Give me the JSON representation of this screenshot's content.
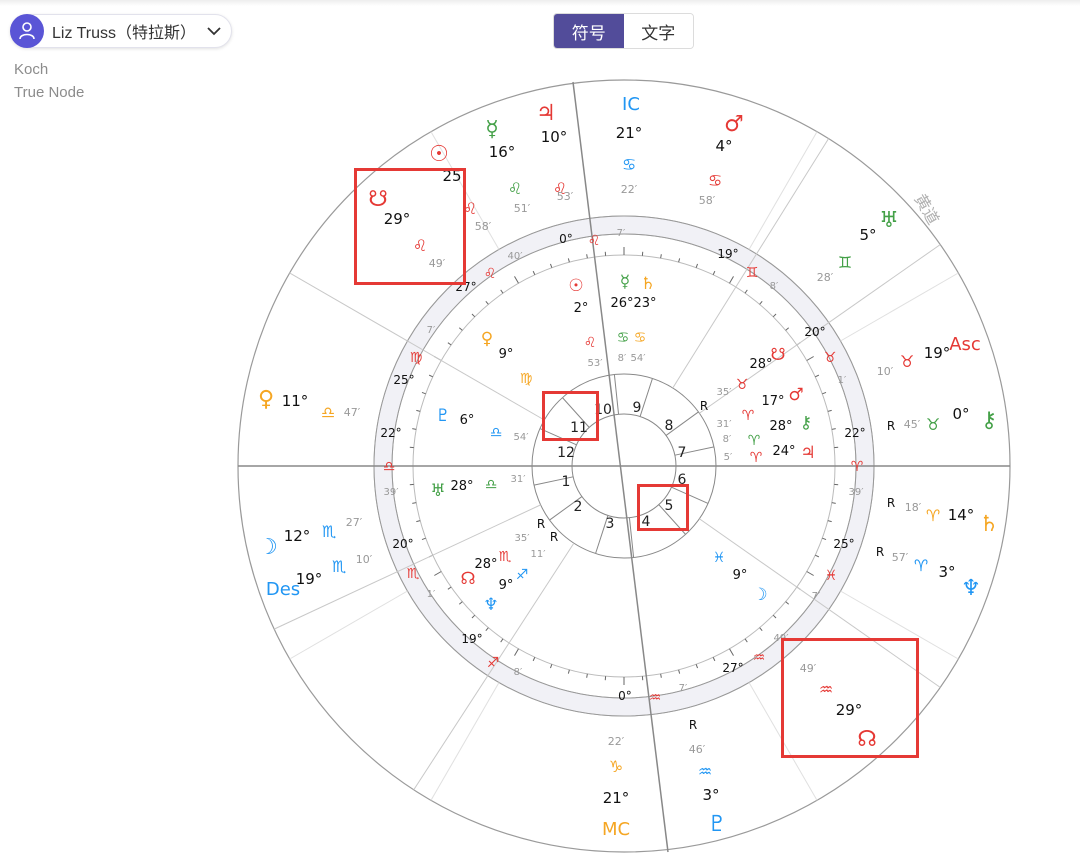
{
  "profile": {
    "name": "Liz Truss（特拉斯）",
    "avatar_icon": "user-icon",
    "dropdown_icon": "chevron-down-icon"
  },
  "settings": {
    "house_system": "Koch",
    "node": "True Node"
  },
  "toggle": {
    "symbols": "符号",
    "text": "文字",
    "active": "symbols"
  },
  "chart": {
    "ring_label": "黄道",
    "angles": [
      {
        "name": "IC",
        "deg": "21°",
        "sign": "♋",
        "min": "22′",
        "color": "#2196f3"
      },
      {
        "name": "Asc",
        "deg": "19°",
        "sign": "♉",
        "min": "10′",
        "color": "#e53935"
      },
      {
        "name": "Des",
        "deg": "19°",
        "sign": "♏",
        "min": "10′",
        "color": "#2196f3"
      },
      {
        "name": "MC",
        "deg": "21°",
        "sign": "♑",
        "min": "22′",
        "color": "#f5a623"
      }
    ],
    "outer_planets": [
      {
        "glyph": "♃",
        "deg": "10°",
        "sign": "♌",
        "min": "53′",
        "color": "#e53935"
      },
      {
        "glyph": "☿",
        "deg": "16°",
        "sign": "♌",
        "min": "51′",
        "color": "#43a047"
      },
      {
        "glyph": "☉",
        "deg": "25",
        "sign": "♌",
        "min": "58′",
        "color": "#e53935"
      },
      {
        "glyph": "☋",
        "deg": "29°",
        "sign": "♌",
        "min": "49′",
        "color": "#e53935"
      },
      {
        "glyph": "♂",
        "deg": "4°",
        "sign": "♋",
        "min": "58′",
        "color": "#e53935"
      },
      {
        "glyph": "♅",
        "deg": "5°",
        "sign": "♊",
        "min": "28′",
        "color": "#43a047"
      },
      {
        "glyph": "⚷",
        "deg": "0°",
        "sign": "♉",
        "min": "45′",
        "color": "#43a047",
        "retro": "R"
      },
      {
        "glyph": "♄",
        "deg": "14°",
        "sign": "♈",
        "min": "18′",
        "color": "#f5a623",
        "retro": "R"
      },
      {
        "glyph": "♆",
        "deg": "3°",
        "sign": "♈",
        "min": "57′",
        "color": "#2196f3",
        "retro": "R"
      },
      {
        "glyph": "☊",
        "deg": "29°",
        "sign": "♒",
        "min": "49′",
        "color": "#e53935"
      },
      {
        "glyph": "♇",
        "deg": "3°",
        "sign": "♒",
        "min": "46′",
        "color": "#2196f3",
        "retro": "R"
      },
      {
        "glyph": "♀",
        "deg": "11°",
        "sign": "♎",
        "min": "47′",
        "color": "#f5a623"
      },
      {
        "glyph": "☽",
        "deg": "12°",
        "sign": "♏",
        "min": "27′",
        "color": "#2196f3"
      }
    ],
    "inner_planets": [
      {
        "glyph": "☉",
        "deg": "2°",
        "sign": "♌",
        "min": "53′",
        "color": "#e53935"
      },
      {
        "glyph": "☿",
        "deg": "26°",
        "sign": "♋",
        "min": "8′",
        "color": "#43a047"
      },
      {
        "glyph": "♄",
        "deg": "23°",
        "sign": "♋",
        "min": "54′",
        "color": "#f5a623"
      },
      {
        "glyph": "♀",
        "deg": "9°",
        "sign": "♍",
        "min": "",
        "color": "#f5a623"
      },
      {
        "glyph": "♇",
        "deg": "6°",
        "sign": "♎",
        "min": "54′",
        "color": "#2196f3"
      },
      {
        "glyph": "♅",
        "deg": "28°",
        "sign": "♎",
        "min": "31′",
        "color": "#43a047"
      },
      {
        "glyph": "☋",
        "deg": "28°",
        "sign": "♉",
        "min": "35′",
        "color": "#e53935"
      },
      {
        "glyph": "♂",
        "deg": "17°",
        "sign": "♈",
        "min": "31′",
        "color": "#e53935",
        "retro": "R"
      },
      {
        "glyph": "⚷",
        "deg": "28°",
        "sign": "♈",
        "min": "8′",
        "color": "#43a047"
      },
      {
        "glyph": "♃",
        "deg": "24°",
        "sign": "♈",
        "min": "5′",
        "color": "#e53935"
      },
      {
        "glyph": "☽",
        "deg": "9°",
        "sign": "♓",
        "min": "",
        "color": "#2196f3"
      },
      {
        "glyph": "☊",
        "deg": "28°",
        "sign": "♏",
        "min": "35′",
        "color": "#e53935",
        "retro": "R"
      },
      {
        "glyph": "♆",
        "deg": "9°",
        "sign": "♐",
        "min": "11′",
        "color": "#2196f3",
        "retro": "R"
      }
    ],
    "cusps": [
      {
        "deg": "0°",
        "sign": "♌",
        "min": "7′"
      },
      {
        "deg": "19°",
        "sign": "♊",
        "min": "8′"
      },
      {
        "deg": "20°",
        "sign": "♉",
        "min": "1′"
      },
      {
        "deg": "22°",
        "sign": "♈",
        "min": "39′"
      },
      {
        "deg": "25°",
        "sign": "♓",
        "min": "7′"
      },
      {
        "deg": "27°",
        "sign": "♒",
        "min": "49′"
      },
      {
        "deg": "0°",
        "sign": "♒",
        "min": "7′"
      },
      {
        "deg": "19°",
        "sign": "♐",
        "min": "8′"
      },
      {
        "deg": "20°",
        "sign": "♏",
        "min": "1′"
      },
      {
        "deg": "22°",
        "sign": "♎",
        "min": "39′"
      },
      {
        "deg": "25°",
        "sign": "♍",
        "min": "7′"
      },
      {
        "deg": "27°",
        "sign": "♌",
        "min": "40′"
      }
    ],
    "houses": [
      "1",
      "2",
      "3",
      "4",
      "5",
      "6",
      "7",
      "8",
      "9",
      "10",
      "11",
      "12"
    ]
  }
}
